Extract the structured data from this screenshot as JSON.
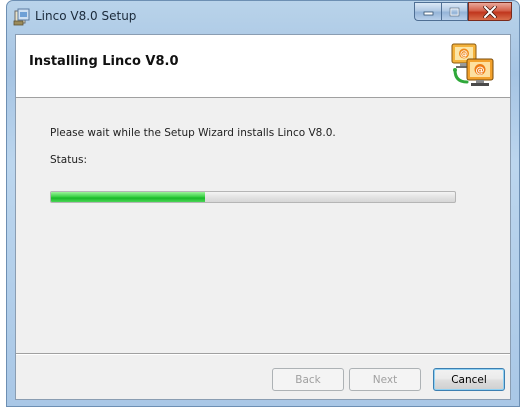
{
  "window": {
    "title": "Linco V8.0 Setup"
  },
  "banner": {
    "title": "Installing Linco V8.0",
    "icon": "network-computers-icon"
  },
  "body": {
    "message": "Please wait while the Setup Wizard installs Linco V8.0.",
    "status_label": "Status:"
  },
  "progress": {
    "fraction": 0.38
  },
  "buttons": {
    "back": "Back",
    "next": "Next",
    "cancel": "Cancel"
  },
  "colors": {
    "progress_green": "#19b928",
    "close_red": "#c0361d"
  }
}
